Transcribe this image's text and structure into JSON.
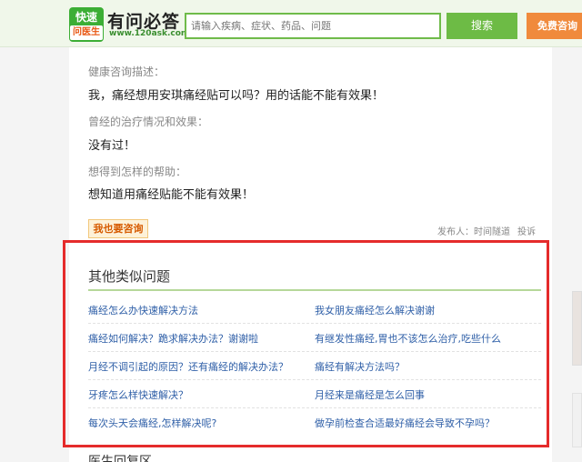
{
  "header": {
    "logo_badge_top": "快速",
    "logo_badge_bottom": "问医生",
    "logo_name": "有问必答",
    "logo_url": "www.120ask.com",
    "search_placeholder": "请输入疾病、症状、药品、问题",
    "search_button": "搜索",
    "consult_button": "免费咨询"
  },
  "question": {
    "desc_label": "健康咨询描述：",
    "desc_text": "我，痛经想用安琪痛经贴可以吗？用的话能不能有效果！",
    "history_label": "曾经的治疗情况和效果：",
    "history_text": "没有过！",
    "help_label": "想得到怎样的帮助：",
    "help_text": "想知道用痛经贴能不能有效果！",
    "ask_button": "我也要咨询",
    "publisher_label": "发布人：",
    "publisher_name": "时间隧道",
    "report_link": "投诉"
  },
  "related": {
    "title": "其他类似问题",
    "left": [
      "痛经怎么办快速解决方法",
      "痛经如何解决？跪求解决办法？谢谢啦",
      "月经不调引起的原因？还有痛经的解决办法？",
      "牙疼怎么样快速解决？",
      "每次头天会痛经,怎样解决呢?"
    ],
    "right": [
      "我女朋友痛经怎么解决谢谢",
      "有继发性痛经,胃也不该怎么治疗,吃些什么",
      "痛经有解决方法吗？",
      "月经来是痛经是怎么回事",
      "做孕前检查合适最好痛经会导致不孕吗？"
    ]
  },
  "doctor_section": {
    "title": "医生回复区"
  }
}
